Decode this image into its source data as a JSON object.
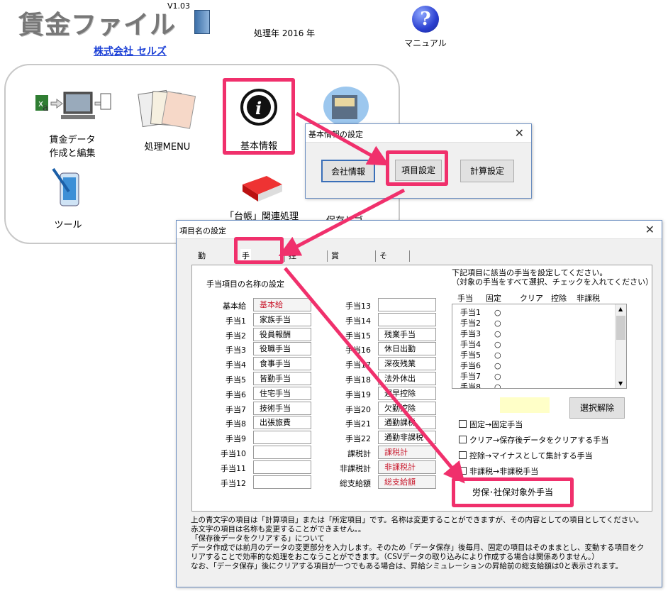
{
  "app": {
    "title": "賃金ファイル",
    "version": "V1.03",
    "company": "株式会社 セルズ",
    "year_text": "処理年 2016 年",
    "manual_label": "マニュアル"
  },
  "launcher": {
    "items": {
      "wage_data": [
        "賃金データ",
        "作成と編集"
      ],
      "menu": "処理MENU",
      "basic_info": "基本情報",
      "tools": "ツール",
      "ledger": "「台帳」関連処理",
      "hidden_partial": "保存しゴ"
    }
  },
  "basic_dialog": {
    "title": "基本情報の設定",
    "close": "✕",
    "buttons": {
      "company": "会社情報",
      "items": "項目設定",
      "calc": "計算設定"
    }
  },
  "item_dialog": {
    "title": "項目名の設定",
    "close": "✕",
    "tabs": [
      "勤怠項目",
      "手当項目",
      "控除項目",
      "賞与の項目",
      "その他"
    ],
    "section_title": "手当項目の名称の設定",
    "left_fields": [
      {
        "label": "基本給",
        "value": "基本給",
        "red": true
      },
      {
        "label": "手当1",
        "value": "家族手当",
        "red": false
      },
      {
        "label": "手当2",
        "value": "役員報酬",
        "red": false
      },
      {
        "label": "手当3",
        "value": "役職手当",
        "red": false
      },
      {
        "label": "手当4",
        "value": "食事手当",
        "red": false
      },
      {
        "label": "手当5",
        "value": "皆勤手当",
        "red": false
      },
      {
        "label": "手当6",
        "value": "住宅手当",
        "red": false
      },
      {
        "label": "手当7",
        "value": "技術手当",
        "red": false
      },
      {
        "label": "手当8",
        "value": "出張旅費",
        "red": false
      },
      {
        "label": "手当9",
        "value": "",
        "red": false
      },
      {
        "label": "手当10",
        "value": "",
        "red": false
      },
      {
        "label": "手当11",
        "value": "",
        "red": false
      },
      {
        "label": "手当12",
        "value": "",
        "red": false
      }
    ],
    "right_fields": [
      {
        "label": "手当13",
        "value": "",
        "red": false
      },
      {
        "label": "手当14",
        "value": "",
        "red": false
      },
      {
        "label": "手当15",
        "value": "残業手当",
        "red": false
      },
      {
        "label": "手当16",
        "value": "休日出勤",
        "red": false
      },
      {
        "label": "手当17",
        "value": "深夜残業",
        "red": false
      },
      {
        "label": "手当18",
        "value": "法外休出",
        "red": false
      },
      {
        "label": "手当19",
        "value": "遅早控除",
        "red": false
      },
      {
        "label": "手当20",
        "value": "欠勤控除",
        "red": false
      },
      {
        "label": "手当21",
        "value": "通勤課税",
        "red": false
      },
      {
        "label": "手当22",
        "value": "通勤非課税",
        "red": false
      },
      {
        "label": "課税計",
        "value": "課税計",
        "red": true
      },
      {
        "label": "非課税計",
        "value": "非課税計",
        "red": true
      },
      {
        "label": "総支給額",
        "value": "総支給額",
        "red": true
      }
    ],
    "instructions": [
      "下記項目に該当の手当を設定してください。",
      "（対象の手当をすべて選択、チェックを入れてください）"
    ],
    "list_headers": [
      "手当",
      "固定",
      "クリア",
      "控除",
      "非課税"
    ],
    "list_rows": [
      {
        "name": "手当1",
        "mark": "○"
      },
      {
        "name": "手当2",
        "mark": "○"
      },
      {
        "name": "手当3",
        "mark": "○"
      },
      {
        "name": "手当4",
        "mark": "○"
      },
      {
        "name": "手当5",
        "mark": "○"
      },
      {
        "name": "手当6",
        "mark": "○"
      },
      {
        "name": "手当7",
        "mark": "○"
      },
      {
        "name": "手当8",
        "mark": "○"
      }
    ],
    "deselect_button": "選択解除",
    "checks": [
      "固定→固定手当",
      "クリア→保存後データをクリアする手当",
      "控除→マイナスとして集計する手当",
      "非課税→非課税手当"
    ],
    "exempt_button": "労保･社保対象外手当",
    "footnotes": [
      "上の青文字の項目は「計算項目」または「所定項目」です。名称は変更することができますが、その内容としての項目としてください。",
      "赤文字の項目は名称も変更することができません。。",
      "「保存後データをクリアする」について",
      "データ作成では前月のデータの変更部分を入力します。そのため「データ保存」後毎月、固定の項目はそのままとし、変動する項目をク",
      "リアすることで効率的な処理をおこなうことができます。（CSVデータの取り込みにより作成する場合は関係ありません。）",
      "なお、「データ保存」後にクリアする項目が一つでもある場合は、昇給シミュレーションの昇給前の総支給額は0と表示されます。"
    ]
  },
  "colors": {
    "highlight": "#f0306c",
    "red_text": "#c8162a",
    "link": "#1a3fd6"
  }
}
